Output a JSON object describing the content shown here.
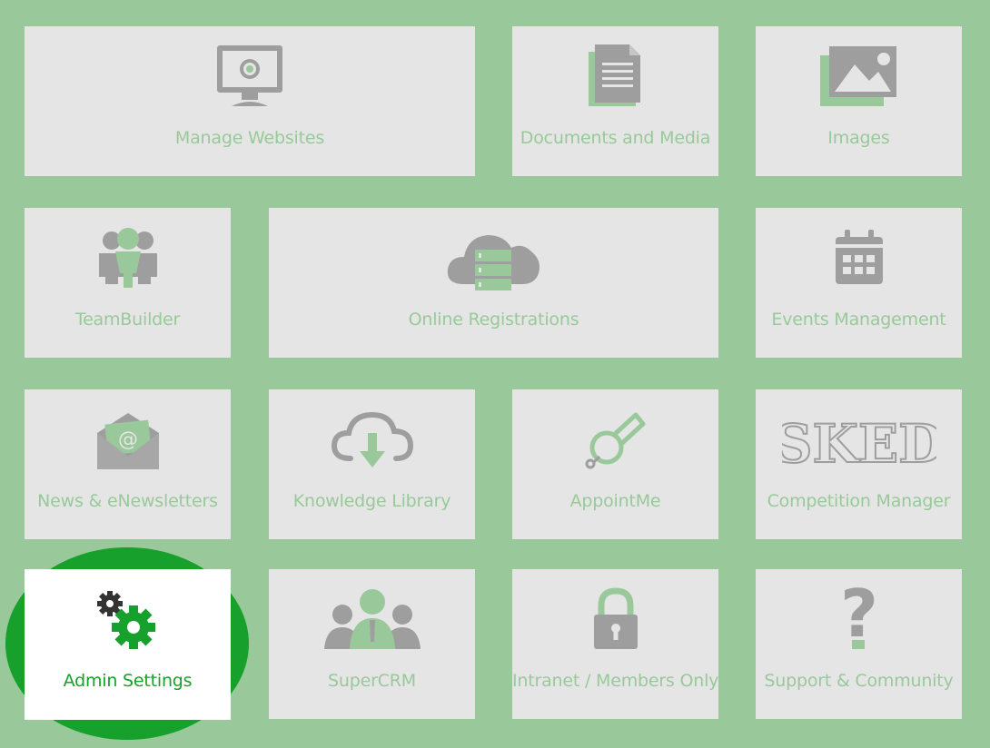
{
  "tiles": [
    {
      "id": "manage-websites",
      "label": "Manage Websites",
      "icon": "monitor-icon"
    },
    {
      "id": "documents-media",
      "label": "Documents and Media",
      "icon": "document-icon"
    },
    {
      "id": "images",
      "label": "Images",
      "icon": "image-icon"
    },
    {
      "id": "teambuilder",
      "label": "TeamBuilder",
      "icon": "team-icon"
    },
    {
      "id": "online-registrations",
      "label": "Online Registrations",
      "icon": "cloud-server-icon"
    },
    {
      "id": "events-management",
      "label": "Events Management",
      "icon": "calendar-icon"
    },
    {
      "id": "news-enewsletters",
      "label": "News & eNewsletters",
      "icon": "envelope-at-icon",
      "icon_text": "@"
    },
    {
      "id": "knowledge-library",
      "label": "Knowledge Library",
      "icon": "cloud-download-icon"
    },
    {
      "id": "appointme",
      "label": "AppointMe",
      "icon": "whistle-icon"
    },
    {
      "id": "competition-manager",
      "label": "Competition Manager",
      "icon": "sked-logo-icon",
      "icon_text": "SKED"
    },
    {
      "id": "admin-settings",
      "label": "Admin Settings",
      "icon": "gears-icon"
    },
    {
      "id": "supercrm",
      "label": "SuperCRM",
      "icon": "people-icon"
    },
    {
      "id": "intranet-members",
      "label": "Intranet / Members Only",
      "icon": "padlock-icon"
    },
    {
      "id": "support-community",
      "label": "Support & Community",
      "icon": "question-icon",
      "icon_text": "?"
    }
  ],
  "colors": {
    "background": "#99c99b",
    "tile": "#e5e5e5",
    "icon_grey": "#9e9e9e",
    "icon_green": "#99c99b",
    "highlight": "#17a02c"
  }
}
